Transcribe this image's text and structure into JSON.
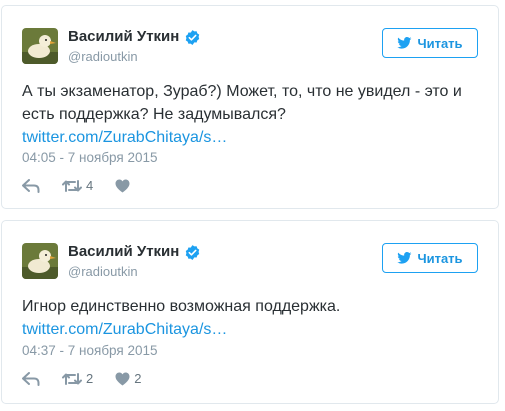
{
  "colors": {
    "accent": "#1da1f2",
    "link": "#1b95e0",
    "muted": "#8899a6",
    "text": "#292f33",
    "border": "#e1e8ed"
  },
  "tweets": [
    {
      "author": {
        "name": "Василий Уткин",
        "handle": "@radioutkin",
        "avatar": "duck-avatar",
        "verified": true
      },
      "follow_label": "Читать",
      "text": "А ты экзаменатор, Зураб?) Может, то, что не увидел - это и есть поддержка? Не задумывался?",
      "link": "twitter.com/ZurabChitaya/s…",
      "timestamp": "04:05 - 7 ноября 2015",
      "actions": {
        "reply": "",
        "retweets": "4",
        "likes": ""
      }
    },
    {
      "author": {
        "name": "Василий Уткин",
        "handle": "@radioutkin",
        "avatar": "duck-avatar",
        "verified": true
      },
      "follow_label": "Читать",
      "text": "Игнор единственно возможная поддержка.",
      "link": "twitter.com/ZurabChitaya/s…",
      "timestamp": "04:37 - 7 ноября 2015",
      "actions": {
        "reply": "",
        "retweets": "2",
        "likes": "2"
      }
    }
  ]
}
